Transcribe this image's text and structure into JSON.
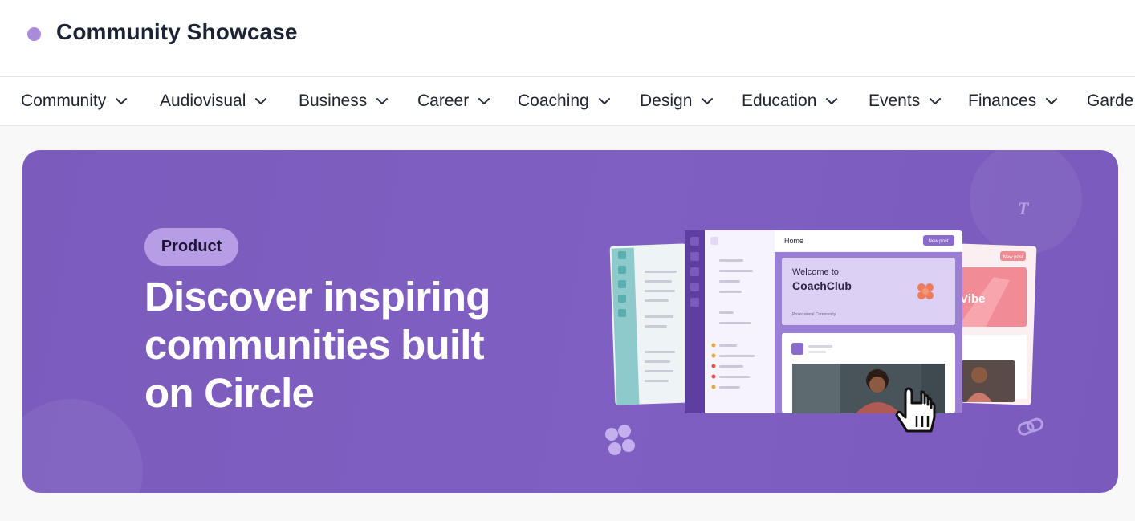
{
  "header": {
    "title": "Community Showcase"
  },
  "nav": {
    "categories": [
      {
        "label": "Community"
      },
      {
        "label": "Audiovisual"
      },
      {
        "label": "Business"
      },
      {
        "label": "Career"
      },
      {
        "label": "Coaching"
      },
      {
        "label": "Design"
      },
      {
        "label": "Education"
      },
      {
        "label": "Events"
      },
      {
        "label": "Finances"
      },
      {
        "label": "Garde"
      }
    ]
  },
  "hero": {
    "badge": "Product",
    "headline_lines": [
      "Discover inspiring",
      "communities built",
      "on Circle"
    ],
    "colors": {
      "background": "#7f5fc1",
      "badge": "#b79ce6",
      "accent": "#8a6bcb"
    },
    "illustration": {
      "center_app": {
        "home_label": "Home",
        "new_post_label": "New post",
        "welcome_line1": "Welcome to",
        "welcome_line2": "CoachClub",
        "welcome_caption": "Professional Community"
      },
      "right_app": {
        "new_post_label": "New post",
        "banner_text": "Vibe"
      },
      "decorations": [
        "text-t-icon",
        "link-icon",
        "flower-logo-icon",
        "hand-pointer-cursor-icon"
      ]
    }
  }
}
